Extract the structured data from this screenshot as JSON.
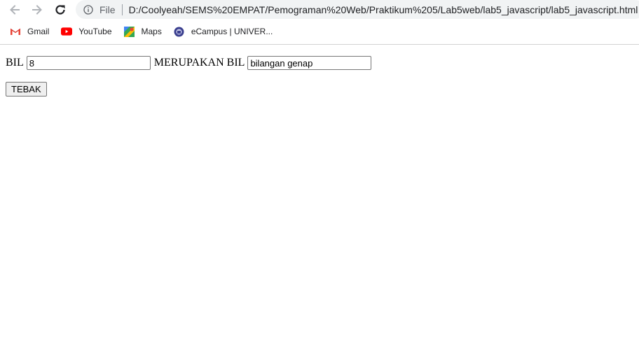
{
  "browser": {
    "file_label": "File",
    "url": "D:/Coolyeah/SEMS%20EMPAT/Pemograman%20Web/Praktikum%205/Lab5web/lab5_javascript/lab5_javascript.html"
  },
  "bookmarks": [
    {
      "label": "Gmail",
      "icon": "gmail-icon"
    },
    {
      "label": "YouTube",
      "icon": "youtube-icon"
    },
    {
      "label": "Maps",
      "icon": "maps-icon"
    },
    {
      "label": "eCampus | UNIVER...",
      "icon": "ecampus-icon"
    }
  ],
  "form": {
    "label_bil": "BIL",
    "bil_value": "8",
    "label_merupakan": "MERUPAKAN BIL",
    "result_value": "bilangan genap",
    "submit_label": "TEBAK"
  },
  "colors": {
    "omnibox_bg": "#f1f3f4",
    "youtube_red": "#ff0000",
    "gmail_red": "#ea4335"
  }
}
